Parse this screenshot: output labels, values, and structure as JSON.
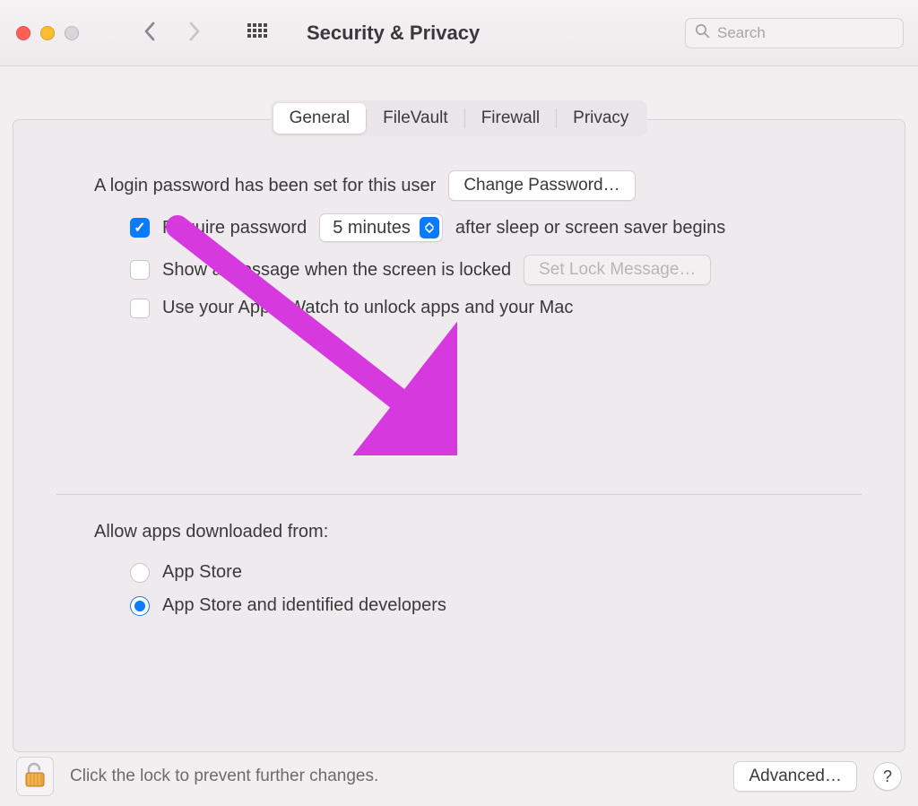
{
  "toolbar": {
    "title": "Security & Privacy",
    "search_placeholder": "Search"
  },
  "tabs": [
    "General",
    "FileVault",
    "Firewall",
    "Privacy"
  ],
  "active_tab": "General",
  "general": {
    "login_set_text": "A login password has been set for this user",
    "change_password_label": "Change Password…",
    "require_password_label": "Require password",
    "require_password_delay": "5 minutes",
    "require_password_tail": "after sleep or screen saver begins",
    "show_message_label": "Show a message when the screen is locked",
    "set_lock_message_label": "Set Lock Message…",
    "apple_watch_label": "Use your Apple Watch to unlock apps and your Mac",
    "allow_apps_title": "Allow apps downloaded from:",
    "radio_appstore": "App Store",
    "radio_identified": "App Store and identified developers"
  },
  "footer": {
    "lock_text": "Click the lock to prevent further changes.",
    "advanced_label": "Advanced…"
  }
}
